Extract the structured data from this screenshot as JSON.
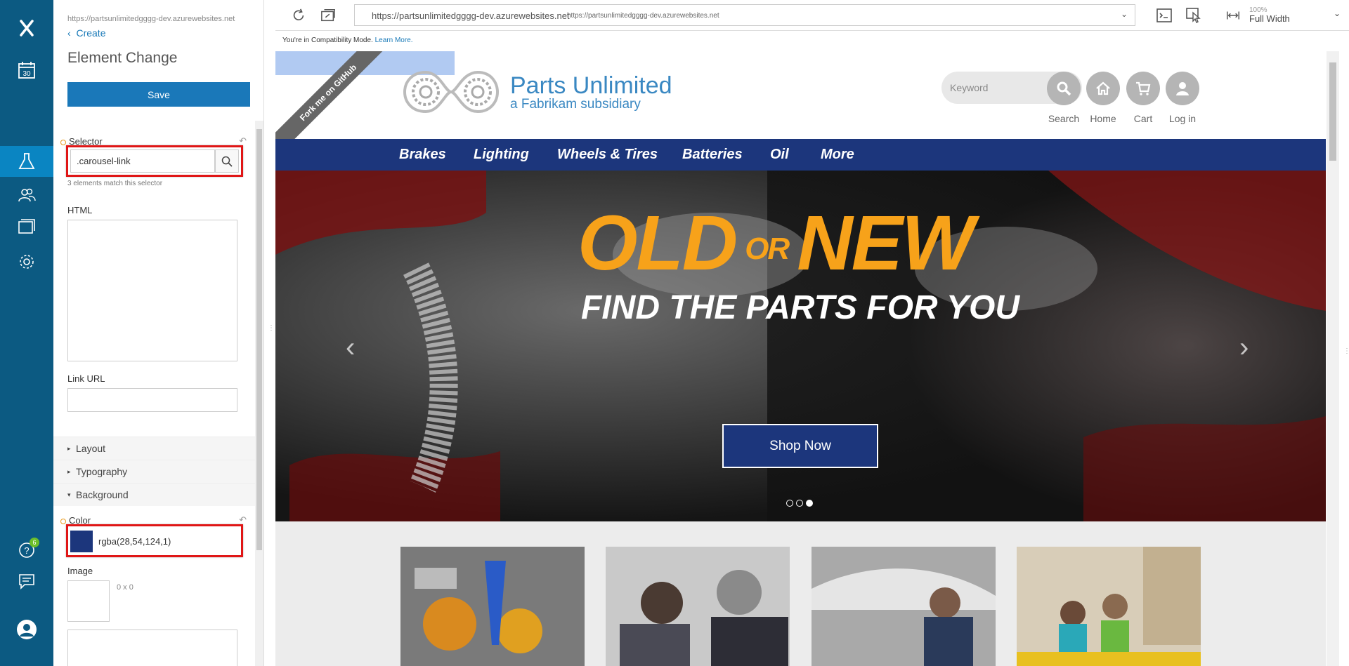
{
  "panel": {
    "url": "https://partsunlimitedgggg-dev.azurewebsites.net",
    "back_label": "Create",
    "title": "Element Change",
    "save_label": "Save",
    "selector_label": "Selector",
    "selector_value": ".carousel-link",
    "match_text": "3 elements match this selector",
    "html_label": "HTML",
    "link_url_label": "Link URL",
    "sections": [
      "Layout",
      "Typography",
      "Background"
    ],
    "color_label": "Color",
    "color_value": "rgba(28,54,124,1)",
    "color_swatch": "#1c367c",
    "image_label": "Image",
    "image_size": "0 x 0"
  },
  "rail": {
    "calendar_day": "30",
    "help_badge": "6"
  },
  "toolbar": {
    "url": "https://partsunlimitedgggg-dev.azurewebsites.net",
    "url_secondary": "https://partsunlimitedgggg-dev.azurewebsites.net",
    "zoom": "100%",
    "width_mode": "Full Width"
  },
  "compat": {
    "text": "You're in Compatibility Mode.",
    "link": "Learn More."
  },
  "site": {
    "ribbon": "Fork me on GitHub",
    "logo_title": "Parts Unlimited",
    "logo_sub": "a Fabrikam subsidiary",
    "search_placeholder": "Keyword",
    "actions": [
      "Search",
      "Home",
      "Cart",
      "Log in"
    ],
    "nav": [
      "Brakes",
      "Lighting",
      "Wheels & Tires",
      "Batteries",
      "Oil",
      "More"
    ],
    "hero_old": "OLD",
    "hero_or": "OR",
    "hero_new": "NEW",
    "hero_sub": "FIND THE PARTS FOR YOU",
    "shop_button": "Shop Now",
    "brand_color": "#1c367c",
    "accent_color": "#f7a21a"
  }
}
